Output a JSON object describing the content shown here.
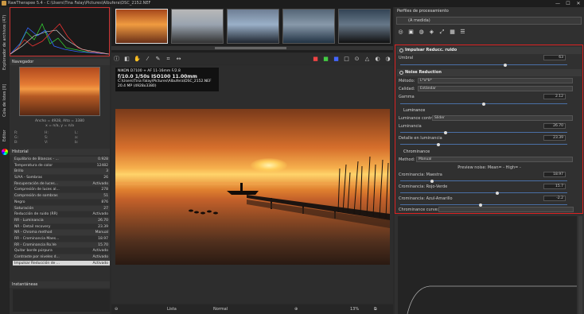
{
  "window": {
    "title": "RawTherapee 5.4 - C:\\Users\\Tina Falay\\Pictures\\Albufera\\DSC_2152.NEF",
    "controls": [
      "—",
      "☐",
      "✕"
    ]
  },
  "vertical_tabs": {
    "file_browser": "Explorador de archivos (47)",
    "queue": "Cola de lotes [0]",
    "editor": "Editor"
  },
  "navigator": {
    "title": "Navegador",
    "size_label": "Ancho = 4928, Alto = 3380",
    "coords_label": "x = n/a, y = n/a",
    "grid": [
      [
        "R:",
        "H:",
        "L:"
      ],
      [
        "G:",
        "S:",
        "a:"
      ],
      [
        "B:",
        "V:",
        "b:"
      ]
    ]
  },
  "history": {
    "title": "Historial",
    "items": [
      {
        "label": "Equilibrio de Blancos - ...",
        "value": "0.928"
      },
      {
        "label": "Temperatura de color",
        "value": "12482"
      },
      {
        "label": "Brillo",
        "value": "3"
      },
      {
        "label": "S/AA - Sombras",
        "value": "26"
      },
      {
        "label": "Recuperación de luces...",
        "value": "Activado"
      },
      {
        "label": "Compresión de luces al...",
        "value": "278"
      },
      {
        "label": "Compresión de sombras",
        "value": "51"
      },
      {
        "label": "Negro",
        "value": "876"
      },
      {
        "label": "Saturación",
        "value": "27"
      },
      {
        "label": "Reducción de ruido (RR)",
        "value": "Activado"
      },
      {
        "label": "RR - Luminancia",
        "value": "26.70"
      },
      {
        "label": "NR - Detail recovery",
        "value": "23.39"
      },
      {
        "label": "NR - Chroma method",
        "value": "Manual"
      },
      {
        "label": "RR - Crominancia Maes...",
        "value": "18.97"
      },
      {
        "label": "RR - Crominancia Ro.Ve",
        "value": "15.70"
      },
      {
        "label": "Quitar borde púrpura",
        "value": "Activado"
      },
      {
        "label": "Contraste por niveles d...",
        "value": "Activado"
      },
      {
        "label": "Impulsar Reducción de ...",
        "value": "Activado"
      }
    ],
    "selected_index": 17
  },
  "snapshots": {
    "title": "Instantáneas",
    "add": "+",
    "remove": "−"
  },
  "exif": {
    "camera": "NIKON D7100 + AF 11-16mm F/2.8",
    "exposure": "f/10.0  1/50s  ISO100  11.00mm",
    "path": "C:\\Users\\Tina Falay\\Pictures\\Albufera\\DSC_2152.NEF",
    "size": "20.4 MP (4928x3380)"
  },
  "bottom_bar": {
    "zoom": "13%",
    "lista_label": "Lista",
    "normal_label": "Normal"
  },
  "right_panel": {
    "header": "Perfiles de procesamiento",
    "profile_value": "(A medida)",
    "impulse_nr": {
      "title": "Impulsar Reducc. ruido",
      "threshold_label": "Umbral",
      "threshold_value": "63",
      "threshold_fraction": 0.63
    },
    "noise_reduction": {
      "title": "Noise Reduction",
      "method_label": "Método:",
      "method_value": "L*a*b*",
      "quality_label": "Calidad:",
      "quality_value": "Estándar",
      "gamma_label": "Gamma",
      "gamma_value": "2.12",
      "gamma_fraction": 0.5,
      "luminance_header": "Luminance",
      "luminance_control_label": "Luminance control:",
      "luminance_control_value": "Slider",
      "luminance_label": "Luminancia",
      "luminance_value": "26.70",
      "luminance_fraction": 0.27,
      "detail_label": "Detalle en luminancia",
      "detail_value": "23.39",
      "detail_fraction": 0.23,
      "chrominance_header": "Chrominance",
      "chroma_method_label": "Method:",
      "chroma_method_value": "Manual",
      "preview_noise_label": "Preview noise: Mean=  -  High=  -",
      "chroma_master_label": "Crominancia: Maestra",
      "chroma_master_value": "18.97",
      "chroma_master_fraction": 0.19,
      "chroma_rg_label": "Crominancia: Rojo-Verde",
      "chroma_rg_value": "15.7",
      "chroma_rg_fraction": 0.58,
      "chroma_by_label": "Crominancia: Azul-Amarillo",
      "chroma_by_value": "-2.2",
      "chroma_by_fraction": 0.48,
      "curve_label": "Chrominance curve:"
    }
  }
}
